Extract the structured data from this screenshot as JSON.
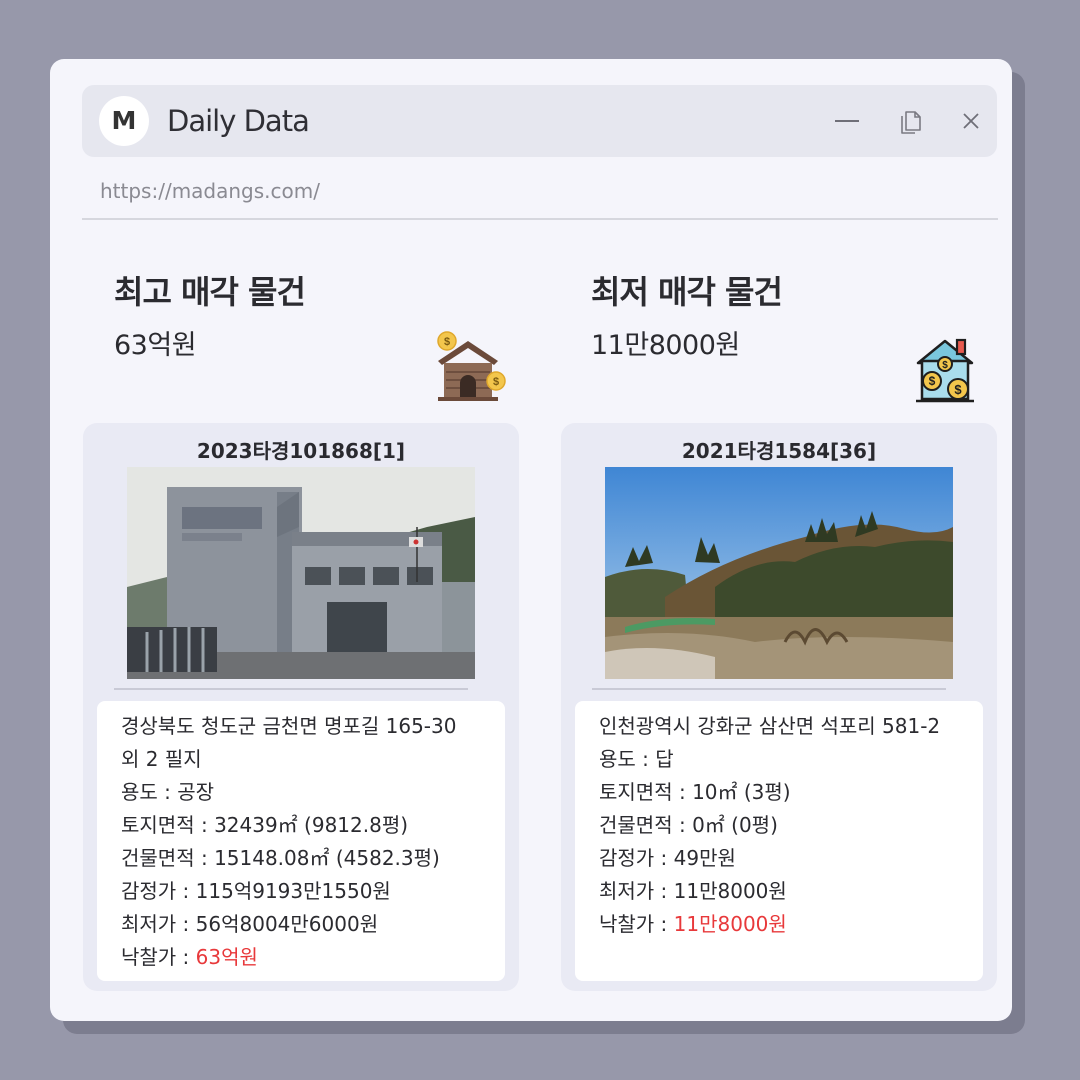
{
  "window": {
    "logo_letter": "M",
    "title": "Daily Data",
    "url": "https://madangs.com/"
  },
  "highest": {
    "heading": "최고 매각 물건",
    "price": "63억원",
    "icon": "house-money-icon",
    "case_no": "2023타경101868[1]",
    "address": "경상북도 청도군 금천면 명포길 165-30 외 2 필지",
    "usage_label": "용도 : ",
    "usage": "공장",
    "land_label": "토지면적 : ",
    "land_area": "32439㎡ (9812.8평)",
    "building_label": "건물면적 : ",
    "building_area": "15148.08㎡ (4582.3평)",
    "appraisal_label": "감정가 : ",
    "appraisal": "115억9193만1550원",
    "minimum_label": "최저가 : ",
    "minimum": "56억8004만6000원",
    "winning_label": "낙찰가 : ",
    "winning": "63억원"
  },
  "lowest": {
    "heading": "최저 매각 물건",
    "price": "11만8000원",
    "icon": "house-coins-icon",
    "case_no": "2021타경1584[36]",
    "address": "인천광역시 강화군 삼산면 석포리 581-2",
    "usage_label": "용도 : ",
    "usage": "답",
    "land_label": "토지면적 : ",
    "land_area": "10㎡ (3평)",
    "building_label": "건물면적 : ",
    "building_area": "0㎡ (0평)",
    "appraisal_label": "감정가 : ",
    "appraisal": "49만원",
    "minimum_label": "최저가 : ",
    "minimum": "11만8000원",
    "winning_label": "낙찰가 : ",
    "winning": "11만8000원"
  },
  "colors": {
    "background": "#9798aa",
    "window": "#f5f5fb",
    "titlebar": "#e6e7ef",
    "card": "#e9eaf4",
    "winning_price": "#e8393b"
  }
}
